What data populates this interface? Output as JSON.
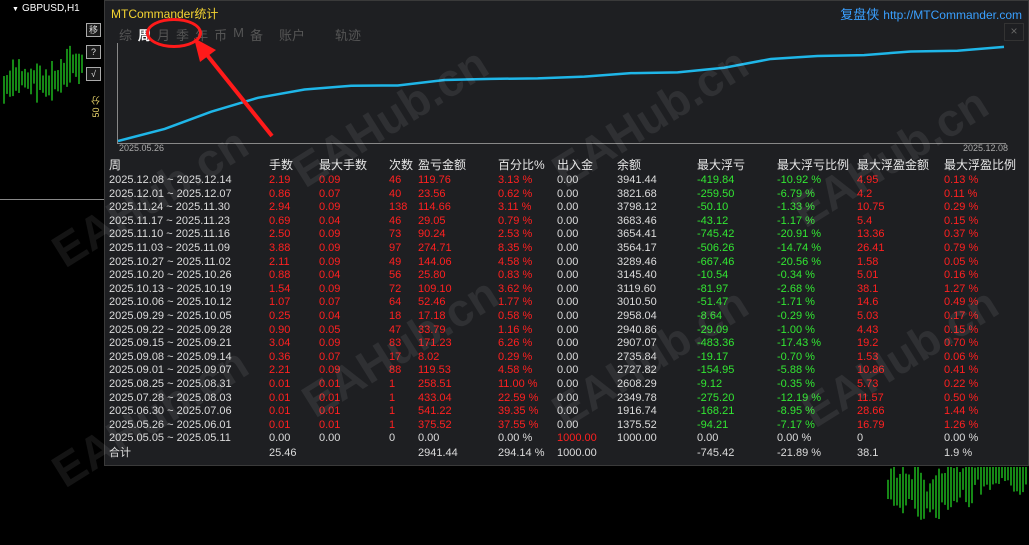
{
  "chart_window": {
    "symbol": "GBPUSD,H1"
  },
  "side_buttons": [
    "移",
    "?",
    "√"
  ],
  "side_text": "50 分",
  "panel": {
    "title": "MTCommander统计",
    "link_cn": "复盘侠",
    "link_url": "http://MTCommander.com",
    "tabs": [
      "综",
      "周",
      "月",
      "季",
      "年",
      "币",
      "M",
      "备",
      "账户",
      "轨迹"
    ],
    "active_tab": 1,
    "close_glyph": "×"
  },
  "plot": {
    "start_date": "2025.05.26",
    "end_date": "2025.12.08",
    "line_color": "#1fb6e8"
  },
  "table": {
    "headers": [
      "周",
      "手数",
      "最大手数",
      "次数",
      "盈亏金额",
      "百分比%",
      "出入金",
      "余额",
      "最大浮亏",
      "最大浮亏比例",
      "最大浮盈金额",
      "最大浮盈比例"
    ],
    "rows": [
      [
        "2025.12.08 ~ 2025.12.14",
        "2.19",
        "0.09",
        "46",
        "119.76",
        "3.13 %",
        "0.00",
        "3941.44",
        "-419.84",
        "-10.92 %",
        "4.95",
        "0.13 %"
      ],
      [
        "2025.12.01 ~ 2025.12.07",
        "0.86",
        "0.07",
        "40",
        "23.56",
        "0.62 %",
        "0.00",
        "3821.68",
        "-259.50",
        "-6.79 %",
        "4.2",
        "0.11 %"
      ],
      [
        "2025.11.24 ~ 2025.11.30",
        "2.94",
        "0.09",
        "138",
        "114.66",
        "3.11 %",
        "0.00",
        "3798.12",
        "-50.10",
        "-1.33 %",
        "10.75",
        "0.29 %"
      ],
      [
        "2025.11.17 ~ 2025.11.23",
        "0.69",
        "0.04",
        "46",
        "29.05",
        "0.79 %",
        "0.00",
        "3683.46",
        "-43.12",
        "-1.17 %",
        "5.4",
        "0.15 %"
      ],
      [
        "2025.11.10 ~ 2025.11.16",
        "2.50",
        "0.09",
        "73",
        "90.24",
        "2.53 %",
        "0.00",
        "3654.41",
        "-745.42",
        "-20.91 %",
        "13.36",
        "0.37 %"
      ],
      [
        "2025.11.03 ~ 2025.11.09",
        "3.88",
        "0.09",
        "97",
        "274.71",
        "8.35 %",
        "0.00",
        "3564.17",
        "-506.26",
        "-14.74 %",
        "26.41",
        "0.79 %"
      ],
      [
        "2025.10.27 ~ 2025.11.02",
        "2.11",
        "0.09",
        "49",
        "144.06",
        "4.58 %",
        "0.00",
        "3289.46",
        "-667.46",
        "-20.56 %",
        "1.58",
        "0.05 %"
      ],
      [
        "2025.10.20 ~ 2025.10.26",
        "0.88",
        "0.04",
        "56",
        "25.80",
        "0.83 %",
        "0.00",
        "3145.40",
        "-10.54",
        "-0.34 %",
        "5.01",
        "0.16 %"
      ],
      [
        "2025.10.13 ~ 2025.10.19",
        "1.54",
        "0.09",
        "72",
        "109.10",
        "3.62 %",
        "0.00",
        "3119.60",
        "-81.97",
        "-2.68 %",
        "38.1",
        "1.27 %"
      ],
      [
        "2025.10.06 ~ 2025.10.12",
        "1.07",
        "0.07",
        "64",
        "52.46",
        "1.77 %",
        "0.00",
        "3010.50",
        "-51.47",
        "-1.71 %",
        "14.6",
        "0.49 %"
      ],
      [
        "2025.09.29 ~ 2025.10.05",
        "0.25",
        "0.04",
        "18",
        "17.18",
        "0.58 %",
        "0.00",
        "2958.04",
        "-8.64",
        "-0.29 %",
        "5.03",
        "0.17 %"
      ],
      [
        "2025.09.22 ~ 2025.09.28",
        "0.90",
        "0.05",
        "47",
        "33.79",
        "1.16 %",
        "0.00",
        "2940.86",
        "-29.09",
        "-1.00 %",
        "4.43",
        "0.15 %"
      ],
      [
        "2025.09.15 ~ 2025.09.21",
        "3.04",
        "0.09",
        "83",
        "171.23",
        "6.26 %",
        "0.00",
        "2907.07",
        "-483.36",
        "-17.43 %",
        "19.2",
        "0.70 %"
      ],
      [
        "2025.09.08 ~ 2025.09.14",
        "0.36",
        "0.07",
        "17",
        "8.02",
        "0.29 %",
        "0.00",
        "2735.84",
        "-19.17",
        "-0.70 %",
        "1.53",
        "0.06 %"
      ],
      [
        "2025.09.01 ~ 2025.09.07",
        "2.21",
        "0.09",
        "88",
        "119.53",
        "4.58 %",
        "0.00",
        "2727.82",
        "-154.95",
        "-5.88 %",
        "10.86",
        "0.41 %"
      ],
      [
        "2025.08.25 ~ 2025.08.31",
        "0.01",
        "0.01",
        "1",
        "258.51",
        "11.00 %",
        "0.00",
        "2608.29",
        "-9.12",
        "-0.35 %",
        "5.73",
        "0.22 %"
      ],
      [
        "2025.07.28 ~ 2025.08.03",
        "0.01",
        "0.01",
        "1",
        "433.04",
        "22.59 %",
        "0.00",
        "2349.78",
        "-275.20",
        "-12.19 %",
        "11.57",
        "0.50 %"
      ],
      [
        "2025.06.30 ~ 2025.07.06",
        "0.01",
        "0.01",
        "1",
        "541.22",
        "39.35 %",
        "0.00",
        "1916.74",
        "-168.21",
        "-8.95 %",
        "28.66",
        "1.44 %"
      ],
      [
        "2025.05.26 ~ 2025.06.01",
        "0.01",
        "0.01",
        "1",
        "375.52",
        "37.55 %",
        "0.00",
        "1375.52",
        "-94.21",
        "-7.17 %",
        "16.79",
        "1.26 %"
      ],
      [
        "2025.05.05 ~ 2025.05.11",
        "0.00",
        "0.00",
        "0",
        "0.00",
        "0.00 %",
        "1000.00",
        "1000.00",
        "0.00",
        "0.00 %",
        "0",
        "0.00 %"
      ]
    ],
    "total": [
      "合计",
      "25.46",
      "",
      "",
      "2941.44",
      "294.14 %",
      "1000.00",
      "",
      "-745.42",
      "-21.89 %",
      "38.1",
      "1.9 %"
    ]
  },
  "watermark": "EAHub.cn",
  "colors": {
    "positive": "#ff2020",
    "negative": "#32e632",
    "title": "#f4d431",
    "link": "#3aa0ff"
  }
}
